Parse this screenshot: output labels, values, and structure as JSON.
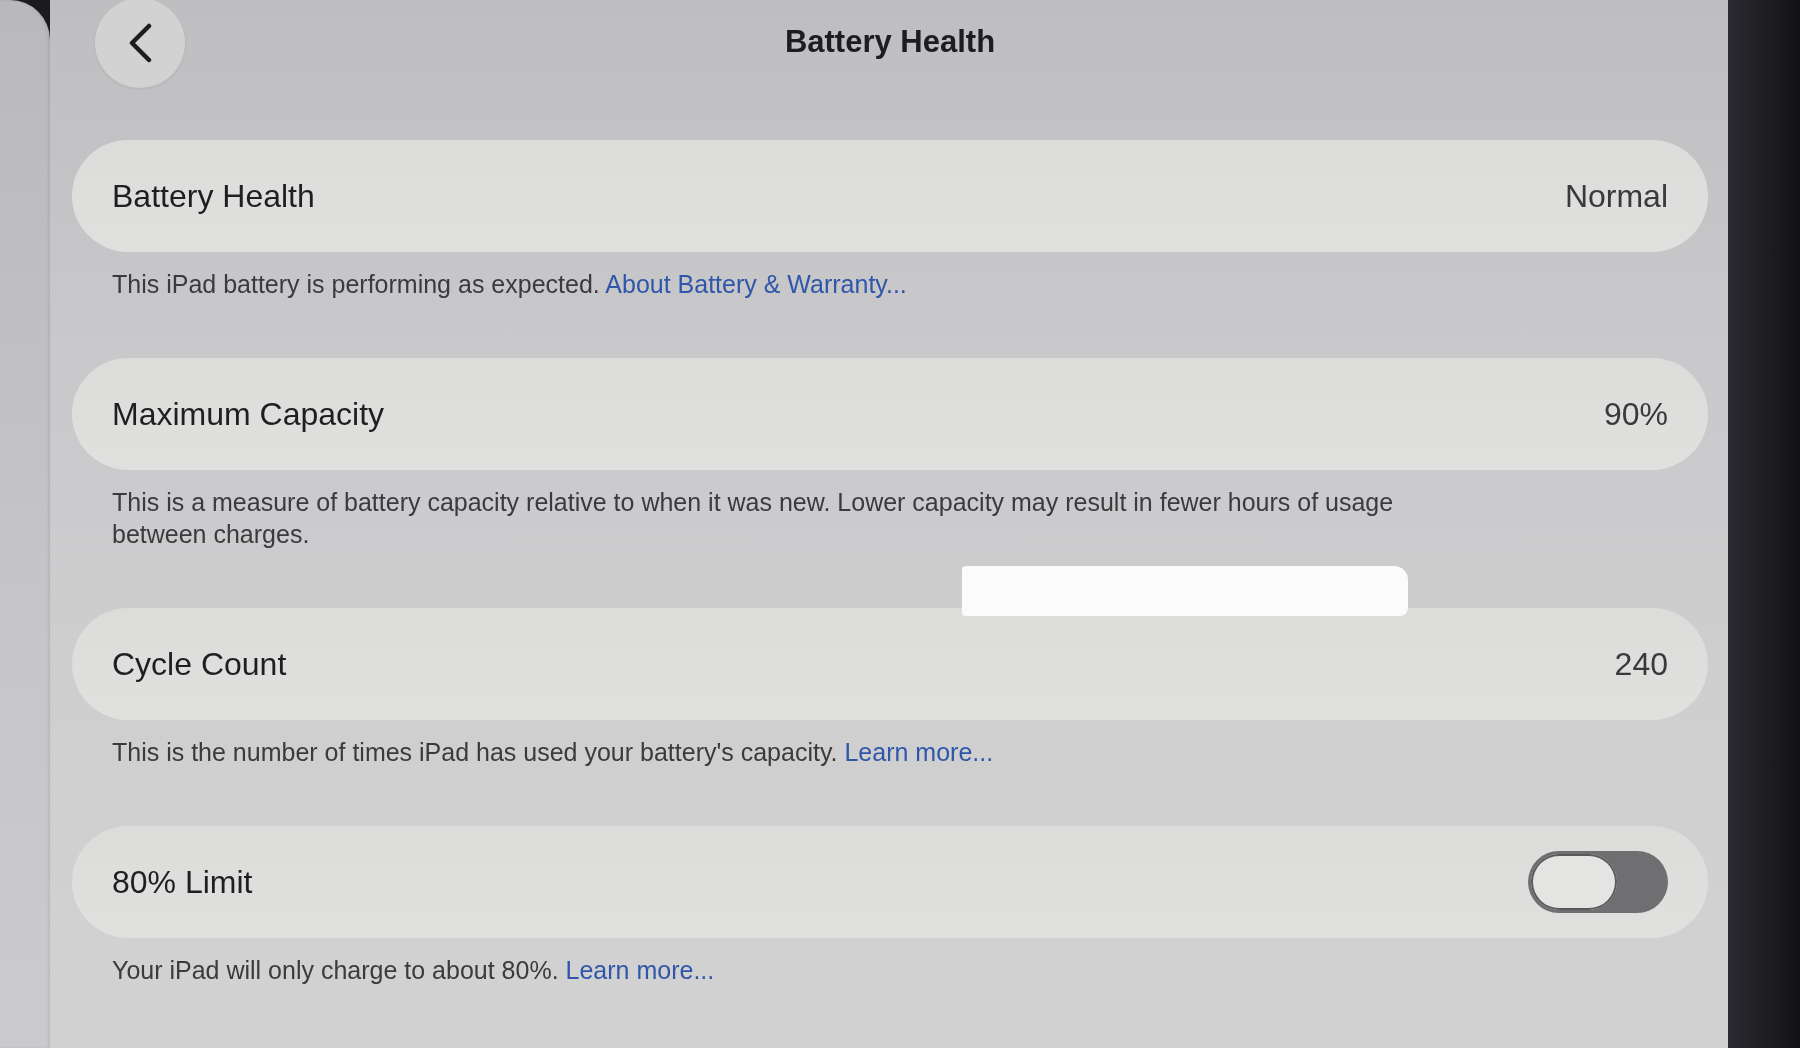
{
  "nav": {
    "title": "Battery Health"
  },
  "sections": [
    {
      "kind": "value",
      "label": "Battery Health",
      "value": "Normal",
      "footer": "This iPad battery is performing as expected.",
      "link": "About Battery & Warranty..."
    },
    {
      "kind": "value",
      "label": "Maximum Capacity",
      "value": "90%",
      "footer": "This is a measure of battery capacity relative to when it was new. Lower capacity may result in fewer hours of usage between charges."
    },
    {
      "kind": "value",
      "label": "Cycle Count",
      "value": "240",
      "footer": "This is the number of times iPad has used your battery's capacity.",
      "link": "Learn more..."
    },
    {
      "kind": "toggle",
      "label": "80% Limit",
      "on": false,
      "footer": "Your iPad will only charge to about 80%.",
      "link": "Learn more..."
    }
  ]
}
